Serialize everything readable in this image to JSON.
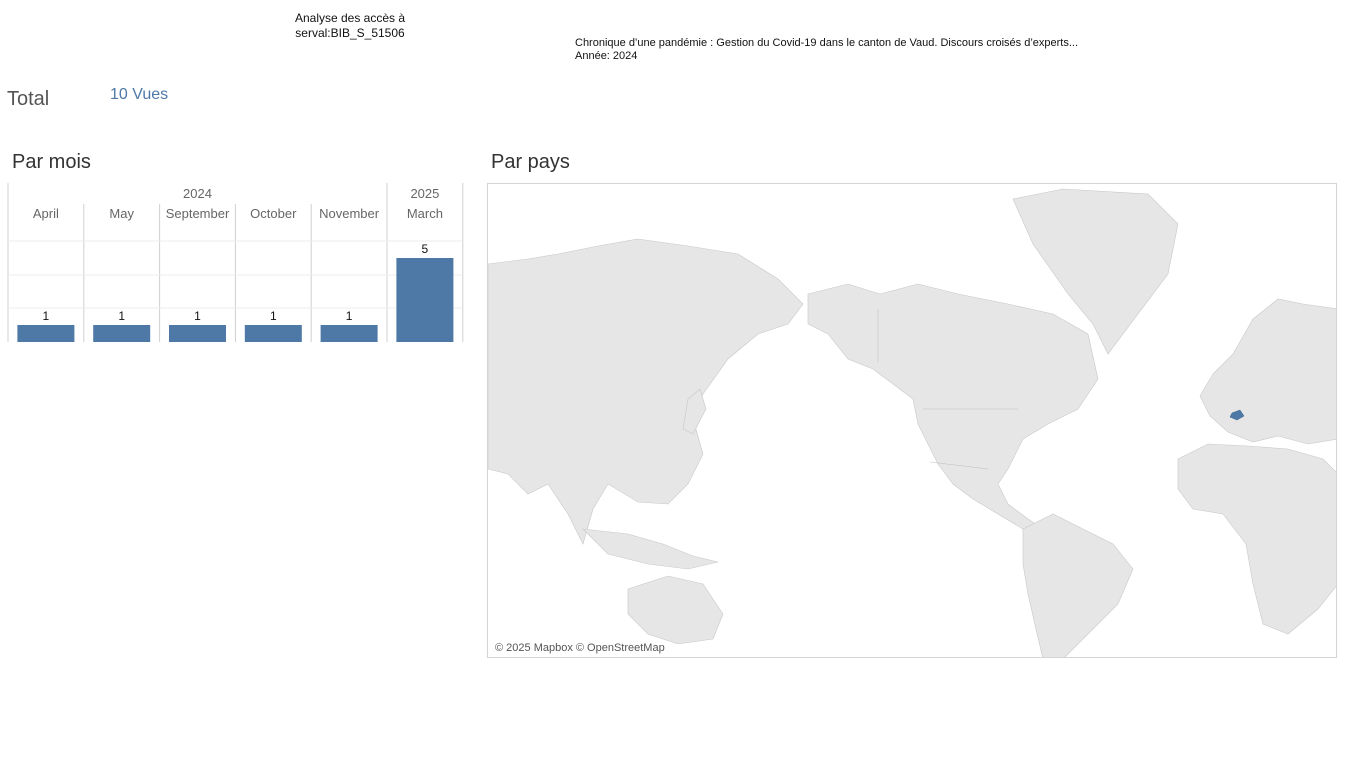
{
  "header": {
    "title_line1": "Analyse des accès à",
    "title_line2": "serval:BIB_S_51506",
    "doc_title": "Chronique d’une pandémie : Gestion du Covid-19 dans le canton de Vaud. Discours croisés d’experts...",
    "doc_year": "Année: 2024"
  },
  "total": {
    "label": "Total",
    "value": "10 Vues"
  },
  "sections": {
    "by_month": "Par mois",
    "by_country": "Par pays"
  },
  "chart_data": {
    "type": "bar",
    "year_groups": [
      {
        "year": "2024",
        "months": [
          "April",
          "May",
          "September",
          "October",
          "November"
        ]
      },
      {
        "year": "2025",
        "months": [
          "March"
        ]
      }
    ],
    "categories": [
      "April",
      "May",
      "September",
      "October",
      "November",
      "March"
    ],
    "values": [
      1,
      1,
      1,
      1,
      1,
      5
    ],
    "ylim": [
      0,
      5
    ],
    "bar_color": "#4e79a7",
    "title": "",
    "xlabel": "",
    "ylabel": ""
  },
  "map": {
    "highlighted_country": "Switzerland",
    "highlight_color": "#4e79a7",
    "credit": "© 2025 Mapbox © OpenStreetMap"
  }
}
